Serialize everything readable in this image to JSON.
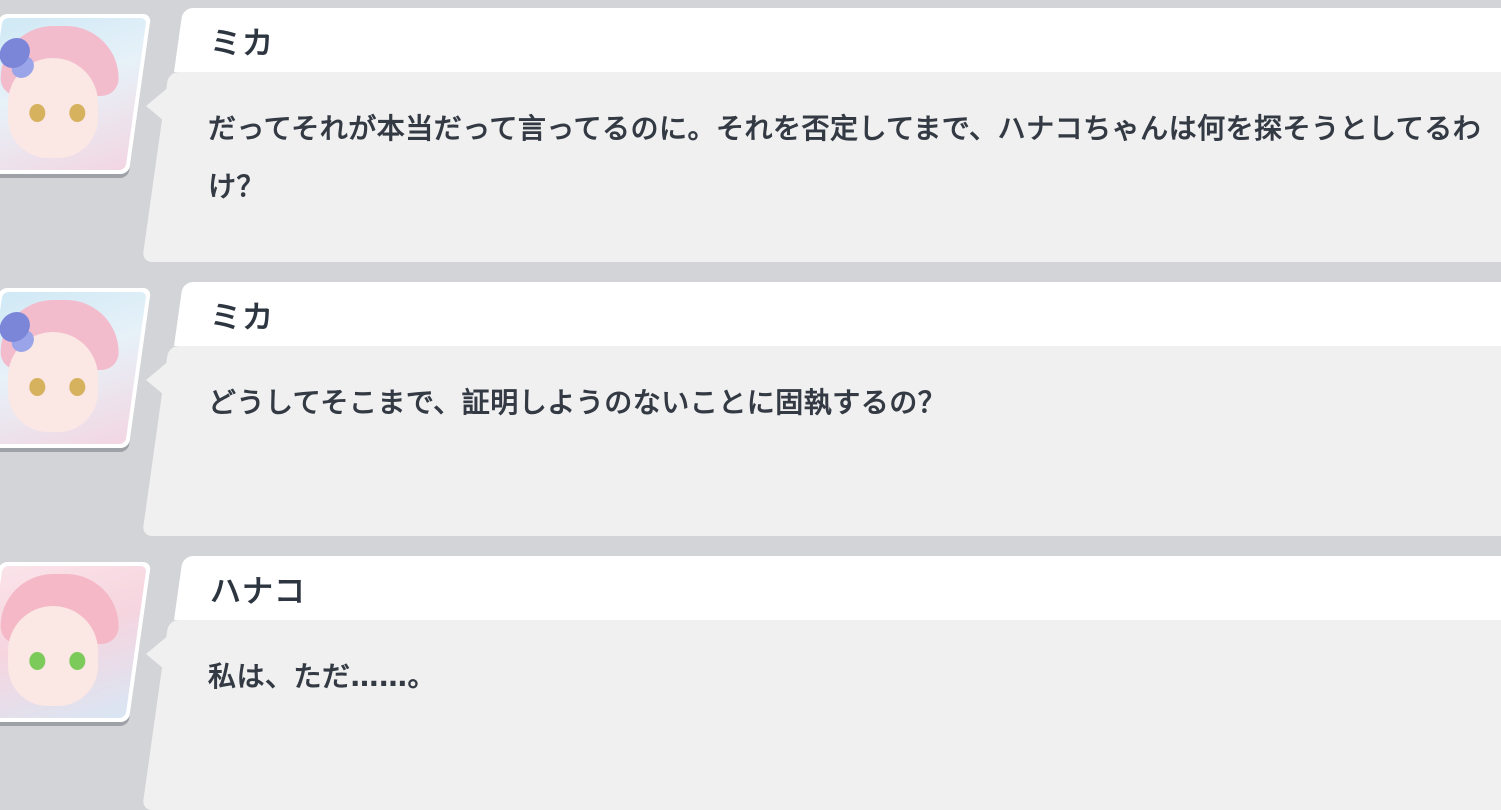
{
  "messages": [
    {
      "speaker": "ミカ",
      "text": "だってそれが本当だって言ってるのに。それを否定してまで、ハナコちゃんは何を探そうとしてるわけ？"
    },
    {
      "speaker": "ミカ",
      "text": "どうしてそこまで、証明しようのないことに固執するの？"
    },
    {
      "speaker": "ハナコ",
      "text": "私は、ただ……。"
    }
  ],
  "colors": {
    "background": "#d3d4d7",
    "name_bar": "#ffffff",
    "text_box": "#f0f0f0",
    "text": "#333a44"
  }
}
